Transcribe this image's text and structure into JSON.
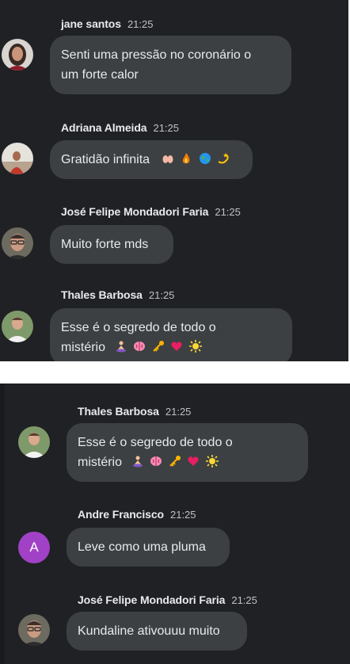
{
  "top_panel": {
    "messages": [
      {
        "sender": "jane santos",
        "time": "21:25",
        "text": "Senti uma pressão no coronário o",
        "text_line2": "um forte calor",
        "avatar": "photo-woman-dark-hair"
      },
      {
        "sender": "Adriana Almeida",
        "time": "21:25",
        "text": "Gratidão infinita",
        "avatar": "photo-woman-outdoor",
        "emojis": [
          "raising-hands-emoji",
          "fire-emoji",
          "globe-emoji",
          "dizzy-emoji"
        ]
      },
      {
        "sender": "José Felipe Mondadori Faria",
        "time": "21:25",
        "text": "Muito forte mds",
        "avatar": "photo-man-glasses"
      },
      {
        "sender": "Thales Barbosa",
        "time": "21:25",
        "text": "Esse é o segredo de todo o",
        "text_line2": "mistério",
        "avatar": "photo-man-light-shirt",
        "emojis": [
          "meditation-emoji",
          "brain-emoji",
          "key-emoji",
          "heart-emoji",
          "sun-emoji"
        ]
      }
    ]
  },
  "bottom_panel": {
    "messages": [
      {
        "sender": "Thales Barbosa",
        "time": "21:25",
        "text": "Esse é o segredo de todo o",
        "text_line2": "mistério",
        "avatar": "photo-man-light-shirt",
        "emojis": [
          "meditation-emoji",
          "brain-emoji",
          "key-emoji",
          "heart-emoji",
          "sun-emoji"
        ]
      },
      {
        "sender": "Andre Francisco",
        "time": "21:25",
        "text": "Leve como uma pluma",
        "avatar_letter": "A",
        "avatar_color": "#a142c6"
      },
      {
        "sender": "José Felipe Mondadori Faria",
        "time": "21:25",
        "text": "Kundaline ativouuu muito",
        "avatar": "photo-man-glasses"
      }
    ]
  },
  "colors": {
    "background": "#202124",
    "bubble": "#3c4043",
    "text": "#e8eaed",
    "time": "#bdc1c6"
  }
}
